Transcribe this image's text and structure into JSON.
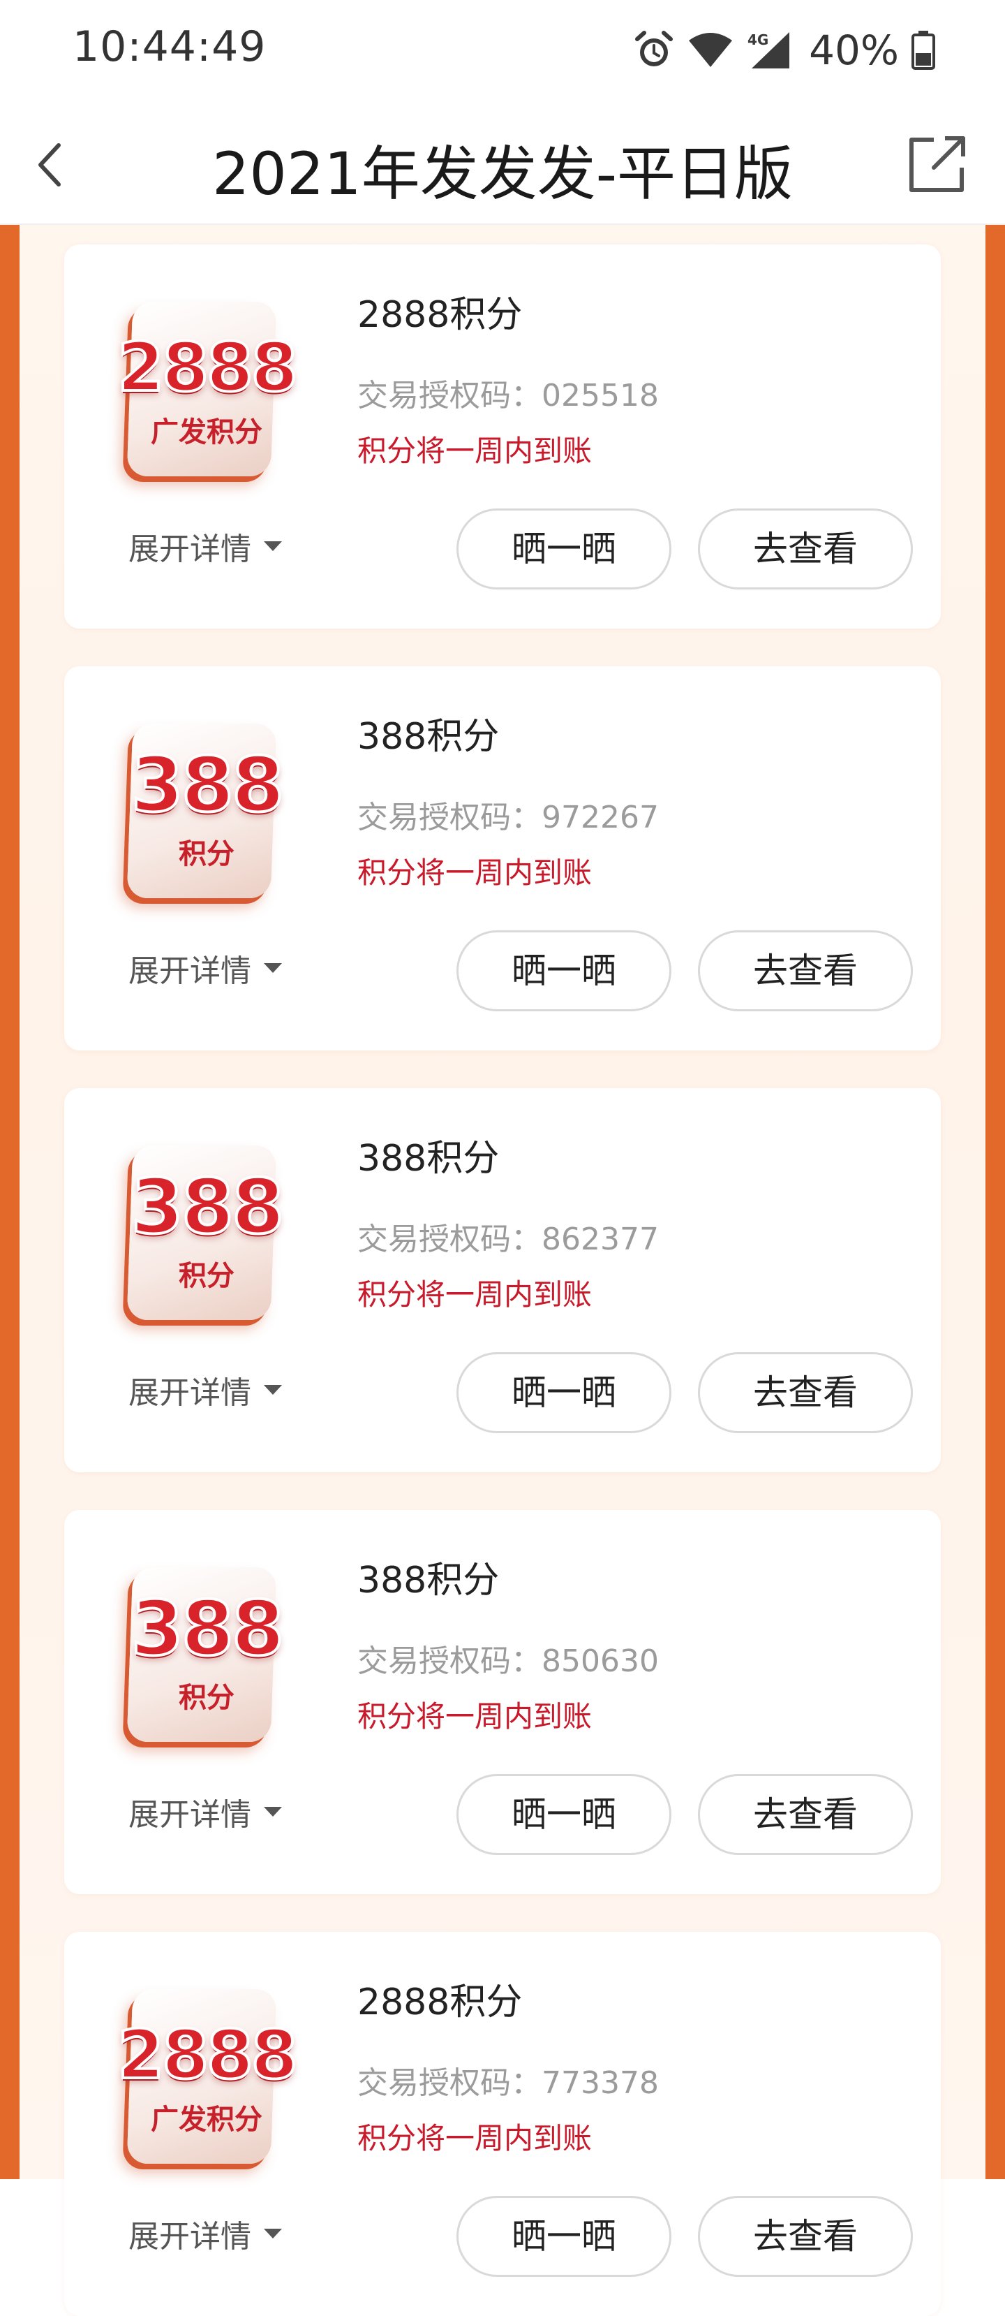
{
  "status_bar": {
    "time": "10:44:49",
    "network": "4G",
    "battery": "40%"
  },
  "header": {
    "title": "2021年发发发-平日版",
    "back_icon": "chevron-left-icon",
    "share_icon": "external-link-icon"
  },
  "colors": {
    "page_border": "#e2692a",
    "notice": "#c81a2a",
    "badge_red": "#d8232a"
  },
  "cards": [
    {
      "badge_number": "2888",
      "badge_text": "广发积分",
      "title": "2888积分",
      "auth_code_label": "交易授权码：",
      "auth_code": "025518",
      "notice": "积分将一周内到账",
      "expand_label": "展开详情",
      "share_label": "晒一晒",
      "view_label": "去查看"
    },
    {
      "badge_number": "388",
      "badge_text": "积分",
      "title": "388积分",
      "auth_code_label": "交易授权码：",
      "auth_code": "972267",
      "notice": "积分将一周内到账",
      "expand_label": "展开详情",
      "share_label": "晒一晒",
      "view_label": "去查看"
    },
    {
      "badge_number": "388",
      "badge_text": "积分",
      "title": "388积分",
      "auth_code_label": "交易授权码：",
      "auth_code": "862377",
      "notice": "积分将一周内到账",
      "expand_label": "展开详情",
      "share_label": "晒一晒",
      "view_label": "去查看"
    },
    {
      "badge_number": "388",
      "badge_text": "积分",
      "title": "388积分",
      "auth_code_label": "交易授权码：",
      "auth_code": "850630",
      "notice": "积分将一周内到账",
      "expand_label": "展开详情",
      "share_label": "晒一晒",
      "view_label": "去查看"
    },
    {
      "badge_number": "2888",
      "badge_text": "广发积分",
      "title": "2888积分",
      "auth_code_label": "交易授权码：",
      "auth_code": "773378",
      "notice": "积分将一周内到账",
      "expand_label": "展开详情",
      "share_label": "晒一晒",
      "view_label": "去查看"
    }
  ]
}
